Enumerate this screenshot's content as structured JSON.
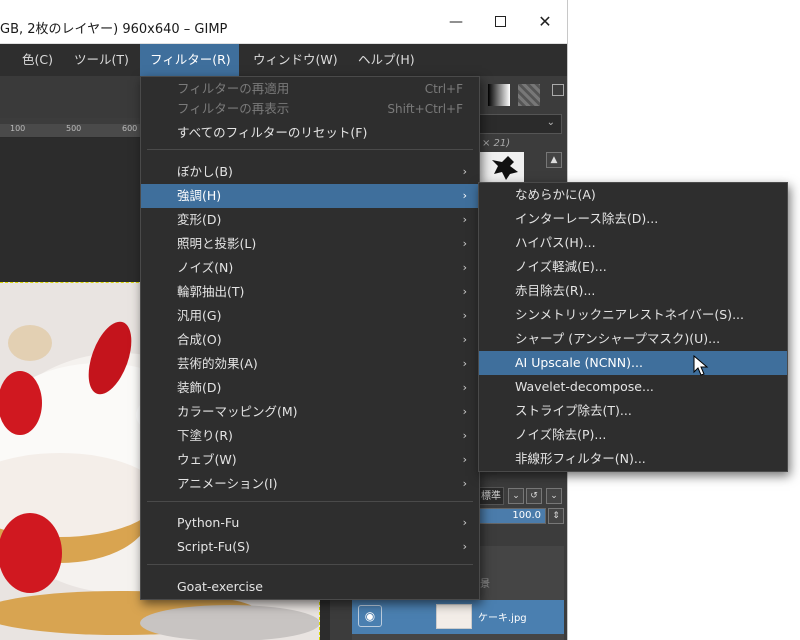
{
  "window": {
    "title": "GB, 2枚のレイヤー) 960x640 – GIMP",
    "minimize_glyph": "—",
    "close_glyph": "✕"
  },
  "menubar": {
    "items": [
      {
        "label": "色(C)"
      },
      {
        "label": "ツール(T)"
      },
      {
        "label": "フィルター(R)"
      },
      {
        "label": "ウィンドウ(W)"
      },
      {
        "label": "ヘルプ(H)"
      }
    ]
  },
  "ruler": {
    "ticks": [
      "100",
      "500",
      "600"
    ]
  },
  "filter_menu": {
    "items": [
      {
        "label": "フィルターの再適用",
        "accel": "Ctrl+F"
      },
      {
        "label": "フィルターの再表示",
        "accel": "Shift+Ctrl+F"
      },
      {
        "label": "すべてのフィルターのリセット(F)"
      },
      {
        "label": "ぼかし(B)"
      },
      {
        "label": "強調(H)"
      },
      {
        "label": "変形(D)"
      },
      {
        "label": "照明と投影(L)"
      },
      {
        "label": "ノイズ(N)"
      },
      {
        "label": "輪郭抽出(T)"
      },
      {
        "label": "汎用(G)"
      },
      {
        "label": "合成(O)"
      },
      {
        "label": "芸術的効果(A)"
      },
      {
        "label": "装飾(D)"
      },
      {
        "label": "カラーマッピング(M)"
      },
      {
        "label": "下塗り(R)"
      },
      {
        "label": "ウェブ(W)"
      },
      {
        "label": "アニメーション(I)"
      },
      {
        "label": "Python-Fu"
      },
      {
        "label": "Script-Fu(S)"
      },
      {
        "label": "Goat-exercise"
      }
    ],
    "arrow": "›"
  },
  "enhance_submenu": {
    "items": [
      {
        "label": "なめらかに(A)"
      },
      {
        "label": "インターレース除去(D)..."
      },
      {
        "label": "ハイパス(H)..."
      },
      {
        "label": "ノイズ軽減(E)..."
      },
      {
        "label": "赤目除去(R)..."
      },
      {
        "label": "シンメトリックニアレストネイバー(S)..."
      },
      {
        "label": "シャープ (アンシャープマスク)(U)..."
      },
      {
        "label": "AI Upscale (NCNN)..."
      },
      {
        "label": "Wavelet-decompose..."
      },
      {
        "label": "ストライプ除去(T)..."
      },
      {
        "label": "ノイズ除去(P)..."
      },
      {
        "label": "非線形フィルター(N)..."
      }
    ]
  },
  "dock": {
    "brush_label": "× 21)",
    "mode_label": "標準",
    "opacity_value": "100.0",
    "layers": [
      {
        "name": "背景"
      },
      {
        "name": "ケーキ.jpg"
      }
    ]
  },
  "colors": {
    "accent": "#3f6f9c",
    "menu_bg": "#2e2e2e",
    "selection_guide": "#d8d400"
  }
}
